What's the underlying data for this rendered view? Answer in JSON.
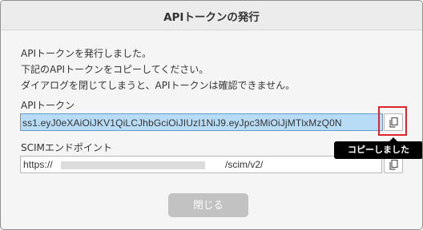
{
  "dialog": {
    "title": "APIトークンの発行",
    "message_lines": [
      "APIトークンを発行しました。",
      "下記のAPIトークンをコピーしてください。",
      "ダイアログを閉じてしまうと、APIトークンは確認できません。"
    ],
    "token": {
      "label": "APIトークン",
      "value": "ss1.eyJ0eXAiOiJKV1QiLCJhbGciOiJIUzI1NiJ9.eyJpc3MiOiJjMTlxMzQ0N",
      "copy_icon": "copy-icon",
      "copy_tooltip": "コピーしました"
    },
    "scim": {
      "label": "SCIMエンドポイント",
      "value_prefix": "https://",
      "value_suffix": "/scim/v2/",
      "copy_icon": "copy-icon"
    },
    "close_label": "閉じる"
  },
  "colors": {
    "selection": "#b8dcf5",
    "highlight": "#e0242a",
    "tooltip_bg": "#000000",
    "button_disabled": "#c2c2c2"
  }
}
